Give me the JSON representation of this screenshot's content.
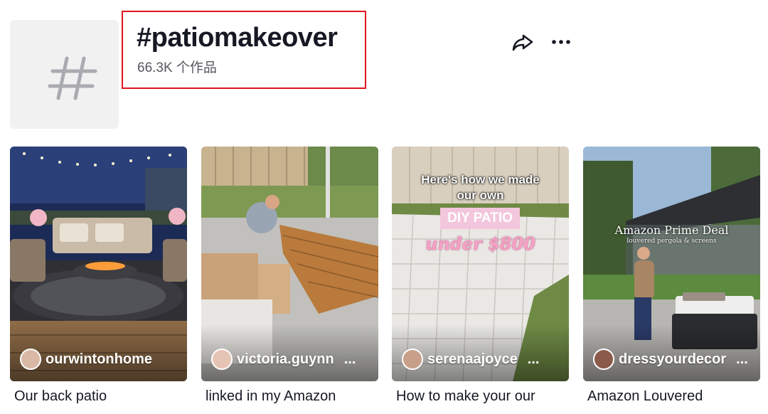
{
  "header": {
    "hashtag_title": "#patiomakeover",
    "post_count": "66.3K 个作品"
  },
  "icons": {
    "hashtag": "hashtag-icon",
    "share": "share-icon",
    "more": "more-icon"
  },
  "colors": {
    "highlight_border": "#e0151e",
    "tile_bg": "#f1f1f2"
  },
  "videos": [
    {
      "username": "ourwintonhome",
      "show_ellipsis": false,
      "caption": "Our back patio"
    },
    {
      "username": "victoria.guynn",
      "ellipsis": "...",
      "caption": "linked in my Amazon"
    },
    {
      "username": "serenaajoyce",
      "ellipsis": "...",
      "caption": "How to make your our",
      "overlay": {
        "line1": "Here's how we made",
        "line2": "our own",
        "badge": "DIY PATIO",
        "script": "under $800"
      }
    },
    {
      "username": "dressyourdecor",
      "ellipsis": "...",
      "caption": "Amazon Louvered",
      "overlay": {
        "title": "Amazon Prime Deal",
        "subtitle": "louvered pergola & screens"
      }
    }
  ]
}
